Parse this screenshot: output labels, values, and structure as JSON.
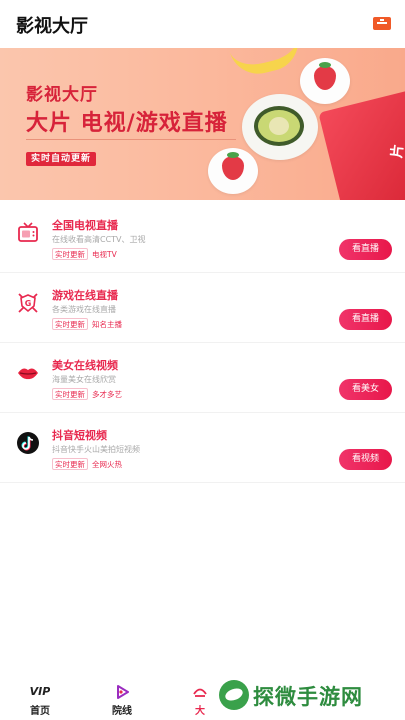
{
  "header": {
    "title": "影视大厅",
    "menu_icon": "list-menu-icon",
    "accent_color": "#f05a28"
  },
  "banner": {
    "title_small": "影视大厅",
    "title_big": "大片 电视/游戏直播",
    "tag": "实时自动更新",
    "box_text": "片",
    "colors": {
      "text": "#d7233a",
      "background": "#fbc6ad"
    }
  },
  "items": [
    {
      "name": "全国电视直播",
      "desc": "在线收看高清CCTV、卫视",
      "tag1": "实时更新",
      "tag2": "电视TV",
      "button": "看直播",
      "icon": "tv-icon"
    },
    {
      "name": "游戏在线直播",
      "desc": "各类游戏在线直播",
      "tag1": "实时更新",
      "tag2": "知名主播",
      "button": "看直播",
      "icon": "game-shield-icon"
    },
    {
      "name": "美女在线视频",
      "desc": "海量美女在线欣赏",
      "tag1": "实时更新",
      "tag2": "多才多艺",
      "button": "看美女",
      "icon": "lips-icon"
    },
    {
      "name": "抖音短视频",
      "desc": "抖音快手火山美拍短视频",
      "tag1": "实时更新",
      "tag2": "全网火热",
      "button": "看视频",
      "icon": "tiktok-icon"
    }
  ],
  "accent": "#e8294f",
  "tabbar": {
    "tabs": [
      {
        "label": "首页",
        "icon": "vip-icon"
      },
      {
        "label": "院线",
        "icon": "play-icon"
      },
      {
        "label": "大",
        "icon": "hall-icon"
      }
    ]
  },
  "watermark": {
    "text": "探微手游网"
  }
}
